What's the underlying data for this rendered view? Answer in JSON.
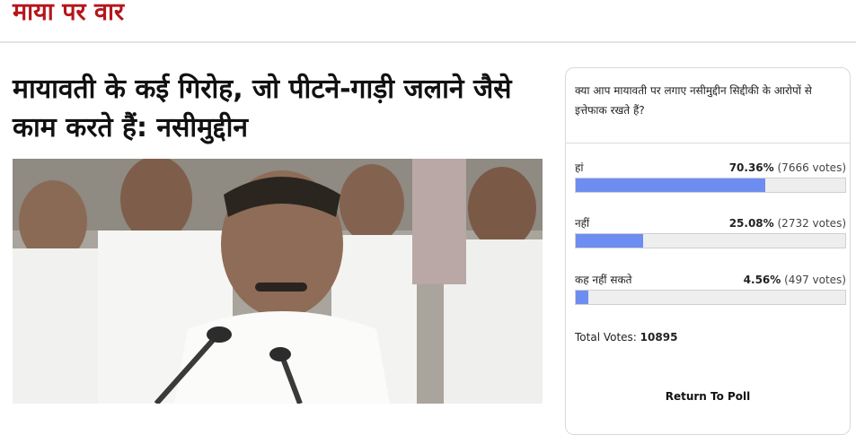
{
  "section": {
    "title": "माया पर वार"
  },
  "article": {
    "headline": "मायावती के कई गिरोह, जो पीटने-गाड़ी जलाने जैसे काम करते हैं: नसीमुद्दीन"
  },
  "poll": {
    "question": "क्या आप मायावती पर लगाए नसीमुद्दीन सिद्दीकी के आरोपों से इत्तेफाक रखते हैं?",
    "options": [
      {
        "label": "हां",
        "percent_text": "70.36%",
        "votes_text": "(7666 votes)",
        "percent": 70.36
      },
      {
        "label": "नहीं",
        "percent_text": "25.08%",
        "votes_text": "(2732 votes)",
        "percent": 25.08
      },
      {
        "label": "कह नहीं सकते",
        "percent_text": "4.56%",
        "votes_text": "(497 votes)",
        "percent": 4.56
      }
    ],
    "total_label": "Total Votes:",
    "total_value": "10895",
    "return_label": "Return To Poll",
    "bar_color": "#6d8df0"
  },
  "colors": {
    "section_title": "#b5161b",
    "headline": "#111111"
  }
}
